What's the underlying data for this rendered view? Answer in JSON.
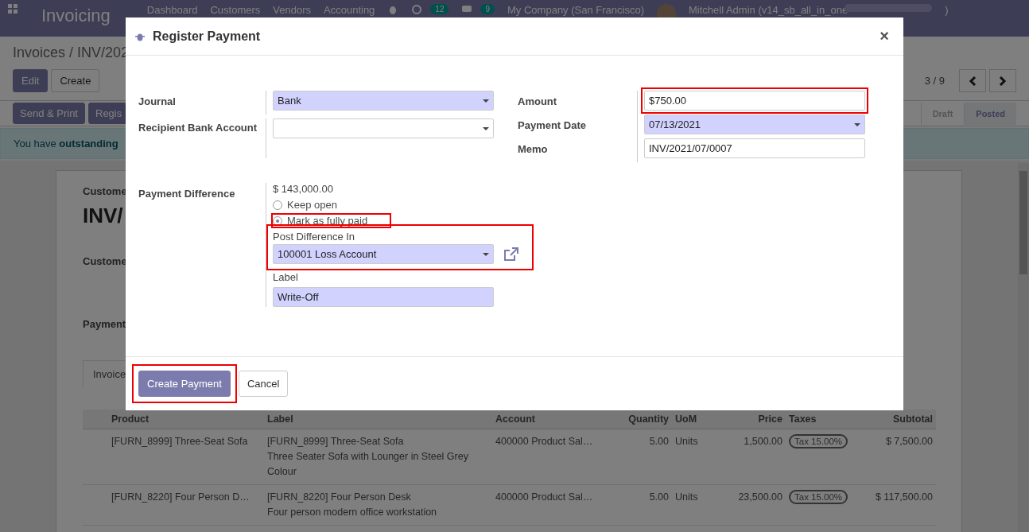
{
  "navbar": {
    "app_title": "Invoicing",
    "menu": [
      "Dashboard",
      "Customers",
      "Vendors",
      "Accounting"
    ],
    "activity_count": "12",
    "message_count": "9",
    "company": "My Company (San Francisco)",
    "user": "Mitchell Admin (v14_sb_all_in_one",
    "user_end": ")"
  },
  "control_panel": {
    "breadcrumb": "Invoices / INV/202",
    "buttons": [
      "Edit",
      "Create"
    ],
    "pager": "3 / 9",
    "action_buttons": [
      "Send & Print",
      "Regis"
    ],
    "statuses": [
      {
        "label": "Draft",
        "selected": false
      },
      {
        "label": "Posted",
        "selected": true
      }
    ]
  },
  "banner": {
    "text": "You have **outstanding**"
  },
  "sheet": {
    "customer_caption": "Custome",
    "invoice_number": "INV/",
    "customer_label": "Custome",
    "payment_label": "Payment",
    "tab": "Invoice",
    "table": {
      "columns": [
        "Product",
        "Label",
        "Account",
        "Quantity",
        "UoM",
        "Price",
        "Taxes",
        "Subtotal"
      ],
      "rows": [
        {
          "product": "[FURN_8999] Three-Seat Sofa",
          "label": [
            "[FURN_8999] Three-Seat Sofa",
            "Three Seater Sofa with Lounger in Steel Grey",
            "Colour"
          ],
          "account": "400000 Product Sal…",
          "quantity": "5.00",
          "uom": "Units",
          "price": "1,500.00",
          "tax": "Tax 15.00%",
          "subtotal": "$ 7,500.00"
        },
        {
          "product": "[FURN_8220] Four Person D…",
          "label": [
            "[FURN_8220] Four Person Desk",
            "Four person modern office workstation"
          ],
          "account": "400000 Product Sal…",
          "quantity": "5.00",
          "uom": "Units",
          "price": "23,500.00",
          "tax": "Tax 15.00%",
          "subtotal": "$ 117,500.00"
        }
      ]
    }
  },
  "dialog": {
    "title": "Register Payment",
    "close": "×",
    "left_fields": [
      {
        "label": "Journal",
        "value": "Bank",
        "kind": "select",
        "required": true
      },
      {
        "label": "Recipient Bank Account",
        "kind": "select",
        "required": false
      }
    ],
    "right_fields": [
      {
        "label": "Amount",
        "value": "$750.00",
        "kind": "input",
        "required": false,
        "highlighted": true
      },
      {
        "label": "Payment Date",
        "value": "07/13/2021",
        "kind": "select",
        "required": true,
        "highlighted": false
      },
      {
        "label": "Memo",
        "value": "INV/2021/07/0007",
        "kind": "input",
        "required": false,
        "highlighted": false
      }
    ],
    "difference": {
      "label": "Payment Difference",
      "amount": "$ 143,000.00",
      "options": [
        {
          "label": "Keep open",
          "selected": false,
          "highlighted": false
        },
        {
          "label": "Mark as fully paid",
          "selected": true,
          "highlighted": true
        }
      ],
      "post_label": "Post Difference In",
      "post_value": "100001 Loss Account",
      "post_highlighted": true,
      "writeoff_label": "Label",
      "writeoff_value": "Write-Off"
    },
    "buttons": [
      {
        "label": "Create Payment",
        "kind": "primary",
        "highlighted": true
      },
      {
        "label": "Cancel",
        "kind": "secondary",
        "highlighted": false
      }
    ]
  }
}
